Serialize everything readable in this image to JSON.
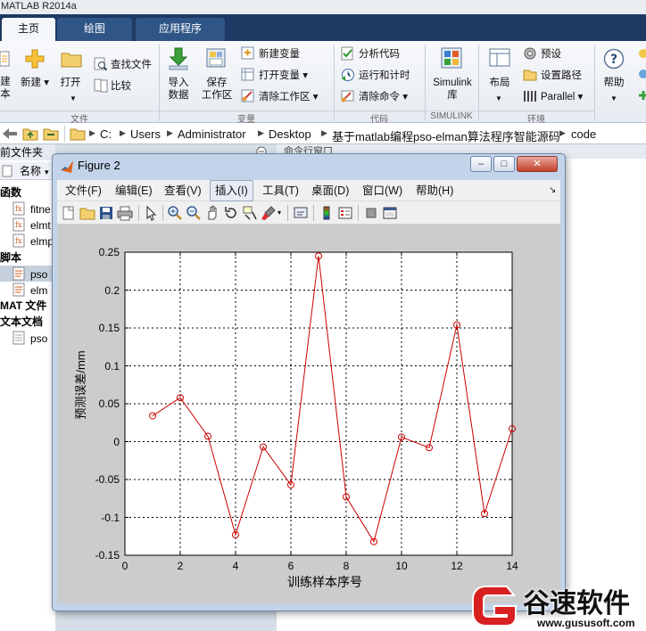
{
  "app": {
    "title": "MATLAB R2014a"
  },
  "tabs": [
    {
      "label": "主页",
      "active": true
    },
    {
      "label": "绘图",
      "active": false
    },
    {
      "label": "应用程序",
      "active": false
    }
  ],
  "ribbon": {
    "new_script_label": "建",
    "new_script_label2": "本",
    "new_label": "新建",
    "open_label": "打开",
    "find_files_label": "查找文件",
    "compare_label": "比较",
    "import_label": "导入",
    "import_label2": "数据",
    "save_ws_label": "保存",
    "save_ws_label2": "工作区",
    "new_var_label": "新建变量",
    "open_var_label": "打开变量",
    "clear_ws_label": "清除工作区",
    "analyze_label": "分析代码",
    "run_time_label": "运行和计时",
    "clear_cmd_label": "清除命令",
    "simulink_label": "Simulink",
    "simulink_label2": "库",
    "layout_label": "布局",
    "prefs_label": "预设",
    "setpath_label": "设置路径",
    "parallel_label": "Parallel",
    "help_label": "帮助",
    "sections": {
      "file": "文件",
      "variable": "变量",
      "code": "代码",
      "simulink": "SIMULINK",
      "env": "环境"
    }
  },
  "address": {
    "path": [
      "C:",
      "Users",
      "Administrator",
      "Desktop",
      "基于matlab编程pso-elman算法程序智能源码",
      "code"
    ]
  },
  "left_panel": {
    "header": "前文件夹",
    "col_name": "名称",
    "groups": {
      "functions": "函数",
      "scripts": "脚本",
      "mat": "MAT 文件",
      "text": "文本文档"
    },
    "files": [
      "fitne",
      "elmt",
      "elmp",
      "pso",
      "elm",
      "pso"
    ]
  },
  "command_window": {
    "title": "命令行窗口"
  },
  "figure": {
    "title": "Figure 2",
    "menus": [
      "文件(F)",
      "编辑(E)",
      "查看(V)",
      "插入(I)",
      "工具(T)",
      "桌面(D)",
      "窗口(W)",
      "帮助(H)"
    ],
    "active_menu": "插入(I)",
    "toolbar_icons": [
      "new-figure-icon",
      "open-icon",
      "save-icon",
      "print-icon",
      "pointer-icon",
      "zoom-in-icon",
      "zoom-out-icon",
      "pan-icon",
      "rotate-icon",
      "data-cursor-icon",
      "brush-icon",
      "link-icon",
      "colorbar-icon",
      "legend-icon",
      "hide-tools-icon",
      "show-tools-icon"
    ]
  },
  "chart_data": {
    "type": "line",
    "title": "",
    "xlabel": "训练样本序号",
    "ylabel": "预测误差/mm",
    "xlim": [
      0,
      14
    ],
    "ylim": [
      -0.15,
      0.25
    ],
    "xticks": [
      0,
      2,
      4,
      6,
      8,
      10,
      12,
      14
    ],
    "yticks": [
      -0.15,
      -0.1,
      -0.05,
      0,
      0.05,
      0.1,
      0.15,
      0.2,
      0.25
    ],
    "ytick_labels": [
      "-0.15",
      "-0.1",
      "-0.05",
      "0",
      "0.05",
      "0.1",
      "0.15",
      "0.2",
      "0.25"
    ],
    "grid": true,
    "series": [
      {
        "color": "#cc0000",
        "marker": "o",
        "x": [
          1,
          2,
          3,
          4,
          5,
          6,
          7,
          8,
          9,
          10,
          11,
          12,
          13,
          14
        ],
        "y": [
          0.034,
          0.058,
          0.007,
          -0.123,
          -0.007,
          -0.057,
          0.245,
          -0.073,
          -0.132,
          0.006,
          -0.008,
          0.154,
          -0.095,
          0.017
        ]
      }
    ]
  },
  "watermark": {
    "name": "谷速软件",
    "url": "www.gususoft.com"
  }
}
